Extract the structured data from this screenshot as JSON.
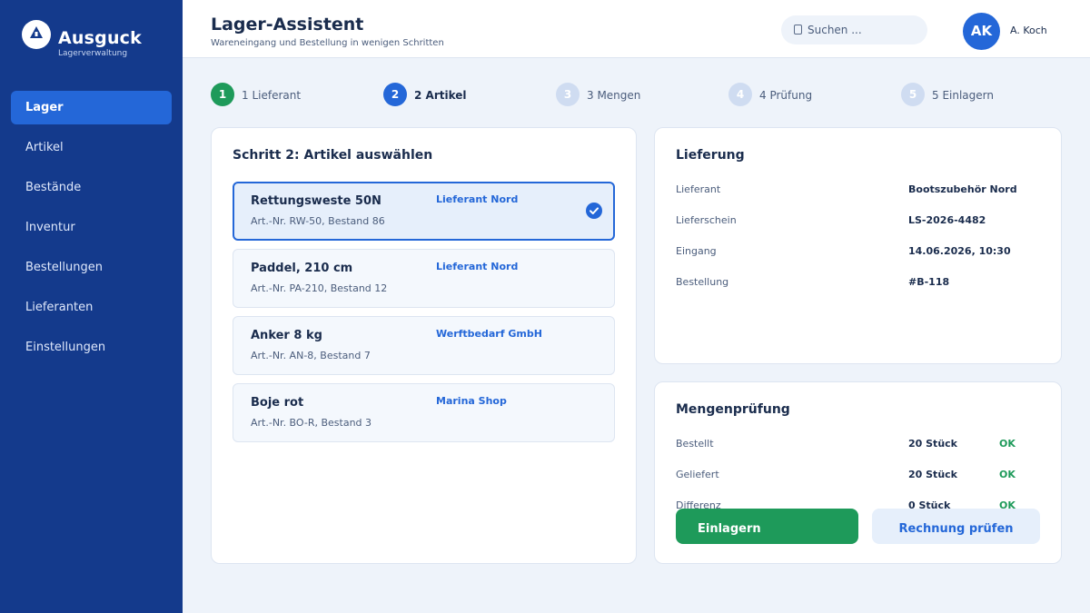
{
  "app": {
    "name": "Ausguck",
    "subtitle": "Lagerverwaltung"
  },
  "sidebar": {
    "items": [
      {
        "label": "Lager",
        "active": true
      },
      {
        "label": "Artikel"
      },
      {
        "label": "Bestände"
      },
      {
        "label": "Inventur"
      },
      {
        "label": "Bestellungen"
      },
      {
        "label": "Lieferanten"
      },
      {
        "label": "Einstellungen"
      }
    ]
  },
  "header": {
    "title": "Lager-Assistent",
    "subtitle": "Wareneingang und Bestellung in wenigen Schritten",
    "search_placeholder": "Suchen ...",
    "user_initials": "AK",
    "user_name": "A. Koch"
  },
  "stepper": {
    "steps": [
      {
        "number": "1",
        "label": "1 Lieferant",
        "state": "done"
      },
      {
        "number": "2",
        "label": "2 Artikel",
        "state": "current"
      },
      {
        "number": "3",
        "label": "3 Mengen",
        "state": "todo"
      },
      {
        "number": "4",
        "label": "4 Prüfung",
        "state": "todo"
      },
      {
        "number": "5",
        "label": "5 Einlagern",
        "state": "todo"
      }
    ]
  },
  "article_select": {
    "title": "Schritt 2: Artikel auswählen",
    "items": [
      {
        "name": "Rettungsweste 50N",
        "meta": "Art.-Nr. RW-50, Bestand 86",
        "supplier": "Lieferant Nord",
        "selected": true
      },
      {
        "name": "Paddel, 210 cm",
        "meta": "Art.-Nr. PA-210, Bestand 12",
        "supplier": "Lieferant Nord"
      },
      {
        "name": "Anker 8 kg",
        "meta": "Art.-Nr. AN-8, Bestand 7",
        "supplier": "Werftbedarf GmbH"
      },
      {
        "name": "Boje rot",
        "meta": "Art.-Nr. BO-R, Bestand 3",
        "supplier": "Marina Shop"
      }
    ]
  },
  "delivery": {
    "title": "Lieferung",
    "rows": [
      {
        "label": "Lieferant",
        "value": "Bootszubehör Nord"
      },
      {
        "label": "Lieferschein",
        "value": "LS-2026-4482"
      },
      {
        "label": "Eingang",
        "value": "14.06.2026, 10:30"
      },
      {
        "label": "Bestellung",
        "value": "#B-118"
      }
    ]
  },
  "quantity_check": {
    "title": "Mengenprüfung",
    "rows": [
      {
        "label": "Bestellt",
        "value": "20 Stück",
        "status": "OK"
      },
      {
        "label": "Geliefert",
        "value": "20 Stück",
        "status": "OK"
      },
      {
        "label": "Differenz",
        "value": "0 Stück",
        "status": "OK"
      }
    ],
    "primary_button": "Einlagern",
    "secondary_button": "Rechnung prüfen"
  },
  "colors": {
    "sidebar_bg": "#143a8c",
    "accent": "#2467d8",
    "success": "#1e9a5a",
    "page_bg": "#eef3fa"
  }
}
